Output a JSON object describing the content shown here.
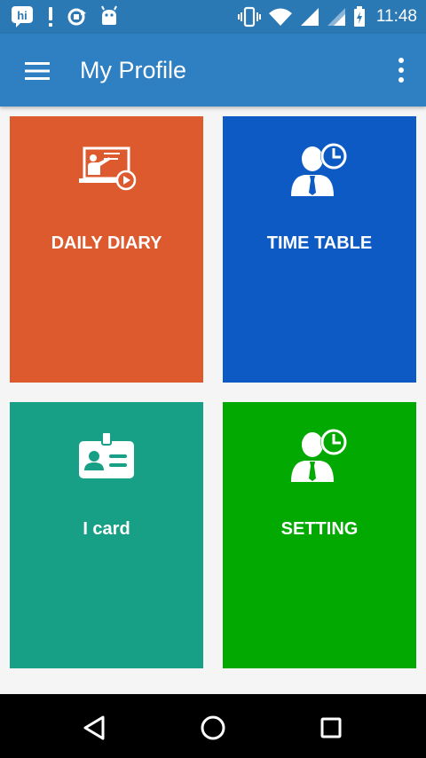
{
  "status_bar": {
    "time": "11:48",
    "left_icons": [
      "hike-icon",
      "alert-icon",
      "sync-icon",
      "android-icon"
    ],
    "right_icons": [
      "vibrate-icon",
      "wifi-icon",
      "signal-icon",
      "signal-icon",
      "battery-charging-icon"
    ]
  },
  "app_bar": {
    "title": "My Profile",
    "menu_icon": "hamburger-menu-icon",
    "more_icon": "more-vertical-icon",
    "color": "#2f80c2"
  },
  "tiles": [
    {
      "label": "DAILY DIARY",
      "icon": "teacher-presentation-icon",
      "color": "#dd5a2e"
    },
    {
      "label": "TIME TABLE",
      "icon": "person-clock-icon",
      "color": "#0d5ac5"
    },
    {
      "label": "I card",
      "icon": "id-card-icon",
      "color": "#17a086"
    },
    {
      "label": "SETTING",
      "icon": "person-clock-icon",
      "color": "#02a900"
    }
  ],
  "nav_bar": {
    "buttons": [
      "back-icon",
      "home-icon",
      "recents-icon"
    ]
  }
}
